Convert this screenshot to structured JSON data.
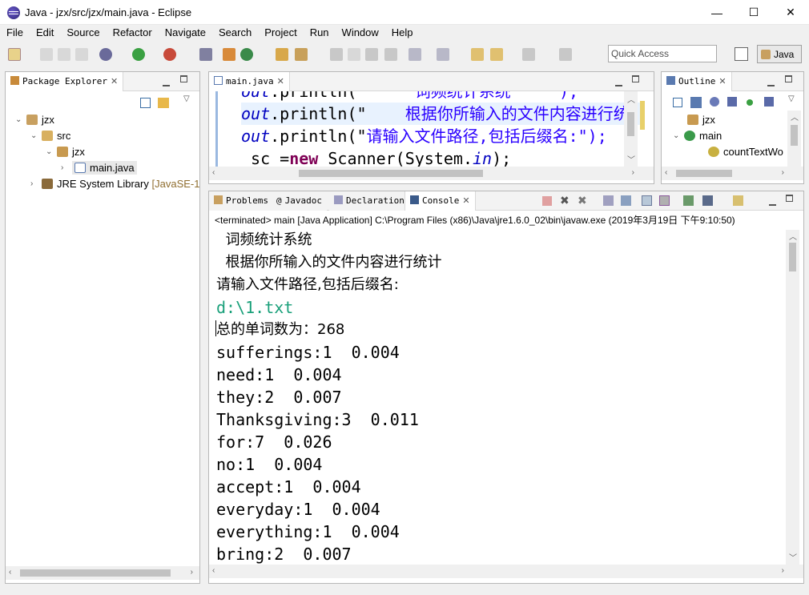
{
  "window": {
    "title": "Java - jzx/src/jzx/main.java - Eclipse",
    "controls": {
      "minimize": "—",
      "maximize": "☐",
      "close": "✕"
    }
  },
  "menu": [
    "File",
    "Edit",
    "Source",
    "Refactor",
    "Navigate",
    "Search",
    "Project",
    "Run",
    "Window",
    "Help"
  ],
  "toolbar": {
    "quick_access_placeholder": "Quick Access",
    "perspective_label": "Java"
  },
  "package_explorer": {
    "tab_label": "Package Explorer",
    "tree": [
      {
        "label": "jzx",
        "icon": "project-icon",
        "arrow": "⌄"
      },
      {
        "label": "src",
        "icon": "source-folder-icon",
        "arrow": "⌄"
      },
      {
        "label": "jzx",
        "icon": "package-icon",
        "arrow": "⌄"
      },
      {
        "label": "main.java",
        "icon": "java-file-icon",
        "arrow": "›",
        "selected": true
      },
      {
        "label": "JRE System Library",
        "suffix": "[JavaSE-1",
        "icon": "library-icon",
        "arrow": "›"
      }
    ]
  },
  "editor": {
    "tab_label": "main.java",
    "lines": [
      {
        "field": "out",
        "mid": ".println(\"",
        "tail": "     词频统计系统    \");"
      },
      {
        "field": "out",
        "mid": ".println(\"",
        "tail": "    根据你所输入的文件内容进行统"
      },
      {
        "field": "out",
        "mid": ".println(\"",
        "tail": "请输入文件路径,包括后缀名:\");"
      },
      {
        "pre": " sc =",
        "kw": "new",
        "tail": " Scanner(System.",
        "field2": "in",
        "end": ");"
      }
    ]
  },
  "outline": {
    "tab_label": "Outline",
    "items": [
      {
        "label": "jzx",
        "icon": "package-icon"
      },
      {
        "label": "main",
        "icon": "class-icon"
      },
      {
        "label": "countTextWo",
        "icon": "static-method-icon"
      }
    ]
  },
  "bottom_tabs": {
    "problems": "Problems",
    "javadoc": "Javadoc",
    "declaration": "Declaration",
    "console": "Console"
  },
  "console": {
    "header": "<terminated> main [Java Application] C:\\Program Files (x86)\\Java\\jre1.6.0_02\\bin\\javaw.exe (2019年3月19日 下午9:10:50)",
    "lines": [
      {
        "text": "  词频统计系统",
        "kind": "cn"
      },
      {
        "text": "  根据你所输入的文件内容进行统计",
        "kind": "cn"
      },
      {
        "text": "请输入文件路径,包括后缀名:",
        "kind": "cn"
      },
      {
        "text": "d:\\1.txt",
        "kind": "input"
      },
      {
        "text": "总的单词数为：268",
        "kind": "cn"
      },
      {
        "text": "sufferings:1  0.004",
        "kind": "out"
      },
      {
        "text": "need:1  0.004",
        "kind": "out"
      },
      {
        "text": "they:2  0.007",
        "kind": "out"
      },
      {
        "text": "Thanksgiving:3  0.011",
        "kind": "out"
      },
      {
        "text": "for:7  0.026",
        "kind": "out"
      },
      {
        "text": "no:1  0.004",
        "kind": "out"
      },
      {
        "text": "accept:1  0.004",
        "kind": "out"
      },
      {
        "text": "everyday:1  0.004",
        "kind": "out"
      },
      {
        "text": "everything:1  0.004",
        "kind": "out"
      },
      {
        "text": "bring:2  0.007",
        "kind": "out"
      }
    ]
  }
}
